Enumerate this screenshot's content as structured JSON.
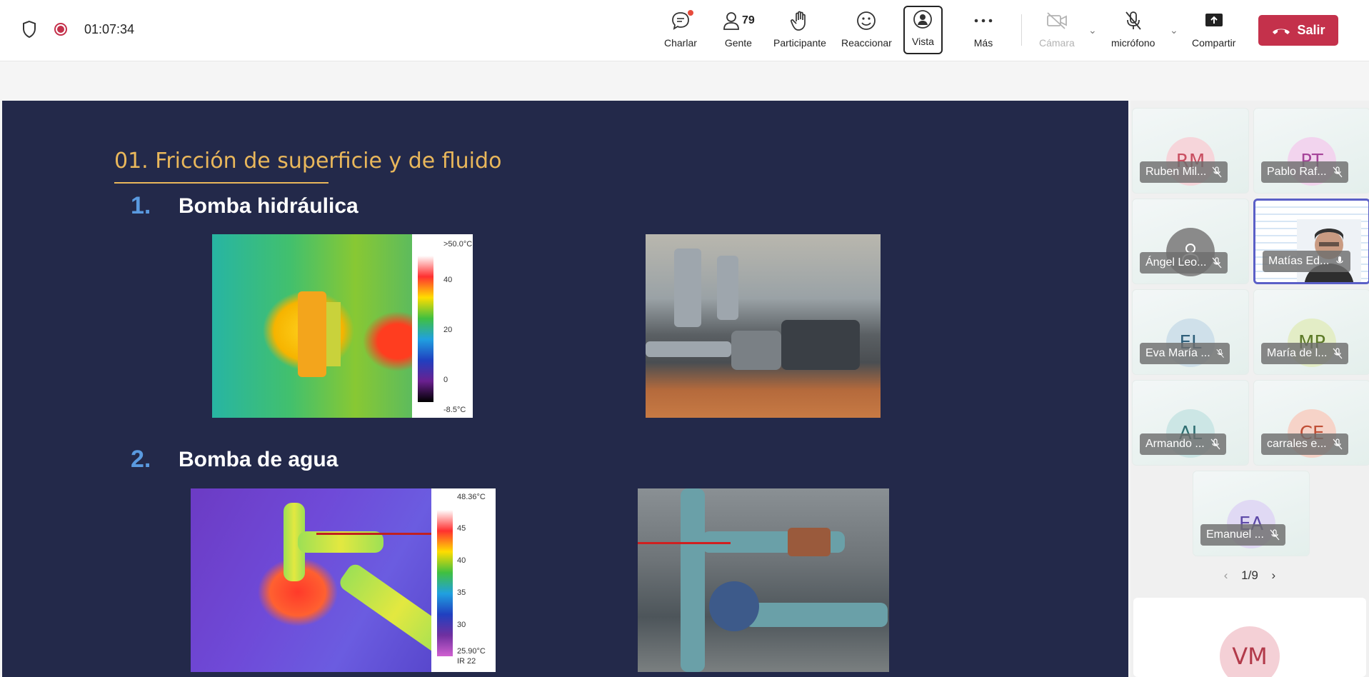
{
  "header": {
    "timer": "01:07:34",
    "buttons": {
      "chat": "Charlar",
      "people": "Gente",
      "people_count": "79",
      "raise_hand": "Participante",
      "react": "Reaccionar",
      "view": "Vista",
      "more": "Más",
      "camera": "Cámara",
      "mic": "micrófono",
      "share": "Compartir"
    },
    "leave": "Salir"
  },
  "slide": {
    "title": "01. Fricción de superficie y de fluido",
    "items": [
      {
        "num": "1.",
        "text": "Bomba hidráulica"
      },
      {
        "num": "2.",
        "text": "Bomba de agua"
      }
    ],
    "scale1": {
      "top": ">50.0°C",
      "t40": "40",
      "t20": "20",
      "t0": "0",
      "bottom": "-8.5°C"
    },
    "scale2": {
      "top": "48.36°C",
      "t45": "45",
      "t40": "40",
      "t35": "35",
      "t30": "30",
      "bottom": "25.90°C",
      "model": "IR 22"
    }
  },
  "participants": [
    {
      "initials": "RM",
      "name": "Ruben Mil...",
      "color": "#c94f61",
      "bg": "#f6d5da"
    },
    {
      "initials": "PT",
      "name": "Pablo Raf...",
      "color": "#a6449a",
      "bg": "#f2d4ee"
    },
    {
      "initials": "",
      "name": "Ángel Leo...",
      "color": "#ffffff",
      "bg": "#8a8a8a"
    },
    {
      "initials": "",
      "name": "Matías Ed...",
      "color": "#333333",
      "bg": "#ffffff"
    },
    {
      "initials": "EL",
      "name": "Eva María ...",
      "color": "#2f5f7a",
      "bg": "#cfe0ea"
    },
    {
      "initials": "MP",
      "name": "María de l...",
      "color": "#5d7a28",
      "bg": "#e3edc6"
    },
    {
      "initials": "AL",
      "name": "Armando ...",
      "color": "#2f6f72",
      "bg": "#cce6e5"
    },
    {
      "initials": "CE",
      "name": "carrales e...",
      "color": "#c04f36",
      "bg": "#f6d3c8"
    },
    {
      "initials": "EA",
      "name": "Emanuel ...",
      "color": "#5e4aa8",
      "bg": "#e0d9f4"
    }
  ],
  "pager": "1/9",
  "bottom_tile": {
    "initials": "VM",
    "color": "#b23a4a",
    "bg": "#f4d0d6"
  }
}
